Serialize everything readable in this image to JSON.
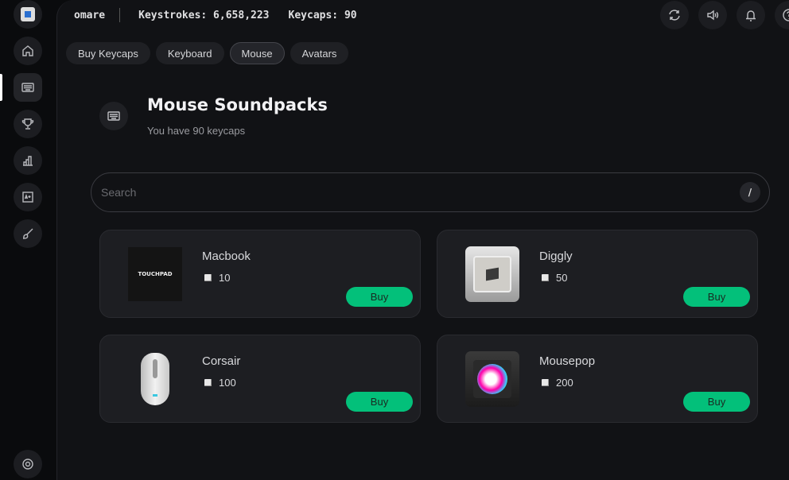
{
  "user": {
    "name": "omare",
    "keystrokes": "Keystrokes: 6,658,223",
    "keycaps": "Keycaps: 90"
  },
  "tabs": [
    {
      "label": "Buy Keycaps"
    },
    {
      "label": "Keyboard"
    },
    {
      "label": "Mouse",
      "selected": true
    },
    {
      "label": "Avatars"
    }
  ],
  "page": {
    "title": "Mouse Soundpacks",
    "subtitle": "You have 90 keycaps"
  },
  "search": {
    "placeholder": "Search",
    "value": "",
    "shortcut": "/"
  },
  "items": [
    {
      "name": "Macbook",
      "price": "10",
      "buy": "Buy",
      "thumb_text": "TOUCHPAD"
    },
    {
      "name": "Diggly",
      "price": "50",
      "buy": "Buy"
    },
    {
      "name": "Corsair",
      "price": "100",
      "buy": "Buy"
    },
    {
      "name": "Mousepop",
      "price": "200",
      "buy": "Buy"
    }
  ],
  "colors": {
    "accent": "#03c07a",
    "background": "#111215",
    "card": "#1d1e22"
  }
}
